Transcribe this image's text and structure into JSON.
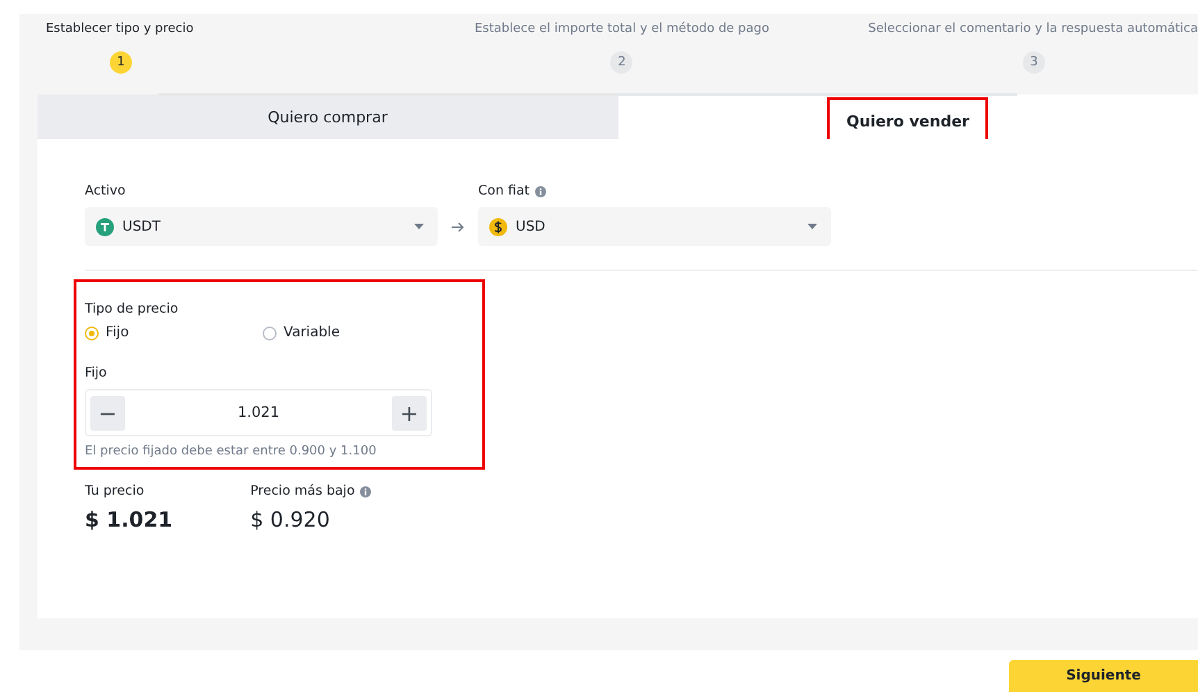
{
  "steps": [
    {
      "label": "Establecer tipo y precio",
      "number": "1",
      "selected": true
    },
    {
      "label": "Establece el importe total y el método de pago",
      "number": "2",
      "selected": false
    },
    {
      "label": "Seleccionar el comentario y la respuesta automática",
      "number": "3",
      "selected": false
    }
  ],
  "tabs": [
    {
      "label": "Quiero comprar",
      "selected": false,
      "highlighted": false
    },
    {
      "label": "Quiero vender",
      "selected": true,
      "highlighted": true
    }
  ],
  "asset": {
    "label": "Activo",
    "value": "USDT"
  },
  "fiat": {
    "label": "Con fiat",
    "value": "USD"
  },
  "price_section": {
    "highlighted": true,
    "label": "Tipo de precio",
    "options": [
      {
        "label": "Fijo",
        "selected": true
      },
      {
        "label": "Variable",
        "selected": false
      }
    ],
    "fixed_label": "Fijo",
    "value": "1.021",
    "minus": "−",
    "plus": "+",
    "hint": "El precio fijado debe estar entre 0.900 y 1.100"
  },
  "your_price": {
    "label": "Tu precio",
    "value": "$ 1.021"
  },
  "lowest_price": {
    "label": "Precio más bajo",
    "value": "$ 0.920"
  },
  "next_button": "Siguiente"
}
